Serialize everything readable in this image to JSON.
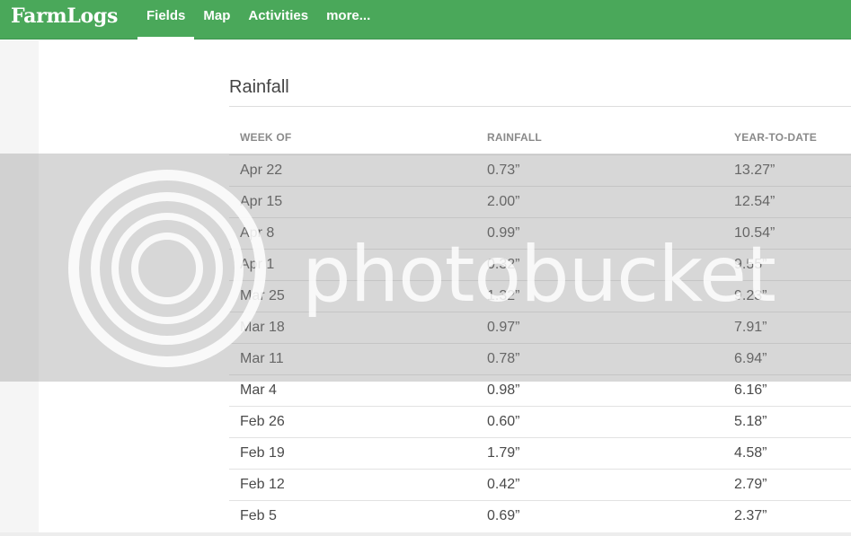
{
  "app": {
    "logo_text": "FarmLogs"
  },
  "nav": {
    "items": [
      {
        "label": "Fields",
        "active": true
      },
      {
        "label": "Map",
        "active": false
      },
      {
        "label": "Activities",
        "active": false
      },
      {
        "label": "more...",
        "active": false
      }
    ]
  },
  "section": {
    "title": "Rainfall"
  },
  "table": {
    "headers": [
      "WEEK OF",
      "RAINFALL",
      "YEAR-TO-DATE"
    ],
    "rows": [
      {
        "week": "Apr 22",
        "rainfall": "0.73”",
        "ytd": "13.27”"
      },
      {
        "week": "Apr 15",
        "rainfall": "2.00”",
        "ytd": "12.54”"
      },
      {
        "week": "Apr 8",
        "rainfall": "0.99”",
        "ytd": "10.54”"
      },
      {
        "week": "Apr 1",
        "rainfall": "0.32”",
        "ytd": "9.55”"
      },
      {
        "week": "Mar 25",
        "rainfall": "1.32”",
        "ytd": "9.23”"
      },
      {
        "week": "Mar 18",
        "rainfall": "0.97”",
        "ytd": "7.91”"
      },
      {
        "week": "Mar 11",
        "rainfall": "0.78”",
        "ytd": "6.94”"
      },
      {
        "week": "Mar 4",
        "rainfall": "0.98”",
        "ytd": "6.16”"
      },
      {
        "week": "Feb 26",
        "rainfall": "0.60”",
        "ytd": "5.18”"
      },
      {
        "week": "Feb 19",
        "rainfall": "1.79”",
        "ytd": "4.58”"
      },
      {
        "week": "Feb 12",
        "rainfall": "0.42”",
        "ytd": "2.79”"
      },
      {
        "week": "Feb 5",
        "rainfall": "0.69”",
        "ytd": "2.37”"
      }
    ]
  },
  "watermark": {
    "text": "photobucket"
  },
  "colors": {
    "brand_green": "#4aa85a",
    "header_text": "#8a8a8a",
    "body_text": "#4a4a4a"
  }
}
